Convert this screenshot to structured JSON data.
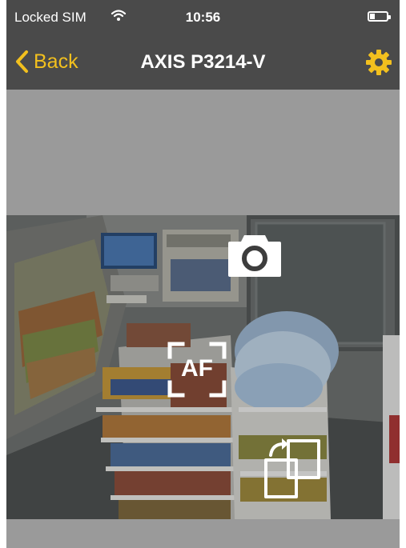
{
  "status_bar": {
    "carrier": "Locked SIM",
    "time": "10:56",
    "battery_level": 0.3
  },
  "nav": {
    "back_label": "Back",
    "title": "AXIS P3214-V"
  },
  "camera_overlay": {
    "autofocus_label": "AF"
  },
  "colors": {
    "accent": "#f2c01e",
    "bar_background": "#4a4a4a",
    "page_background": "#9a9a9a"
  },
  "icons": {
    "wifi": "wifi-icon",
    "battery": "battery-icon",
    "back": "chevron-left-icon",
    "settings": "gear-icon",
    "snapshot": "camera-icon",
    "autofocus": "autofocus-icon",
    "switch": "switch-stream-icon"
  }
}
